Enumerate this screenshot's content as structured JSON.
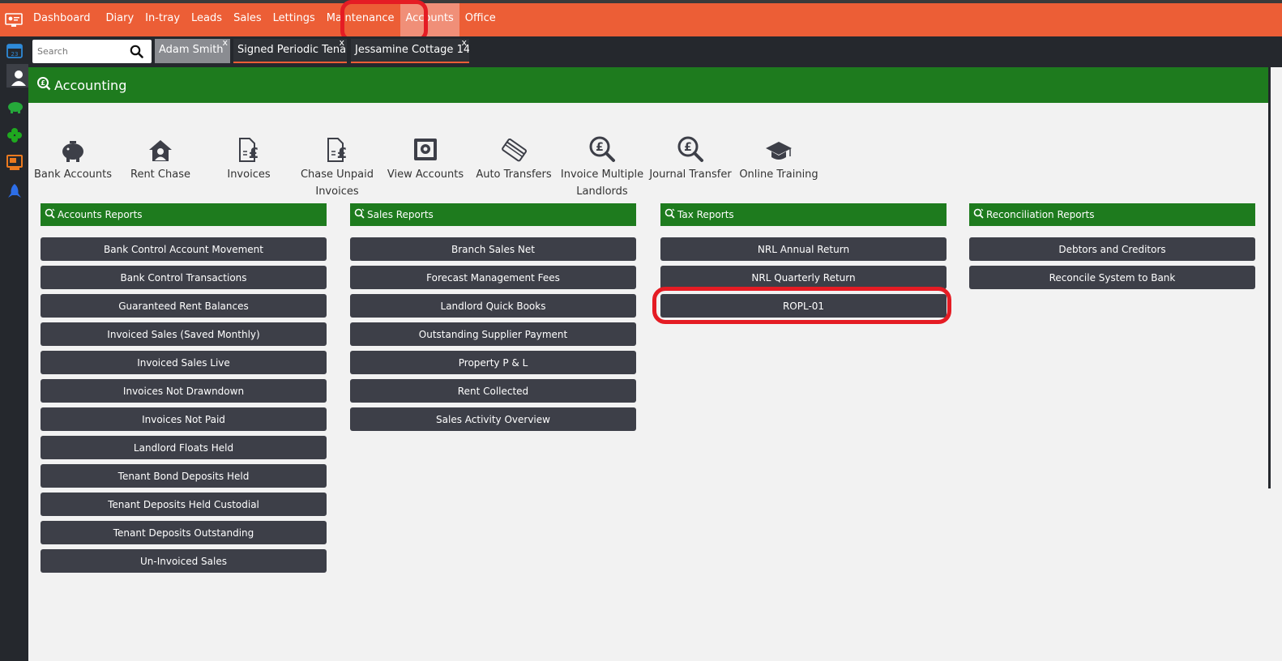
{
  "topnav": {
    "items": [
      {
        "label": "Dashboard",
        "active": false
      },
      {
        "label": "Diary",
        "active": false
      },
      {
        "label": "In-tray",
        "active": false
      },
      {
        "label": "Leads",
        "active": false
      },
      {
        "label": "Sales",
        "active": false
      },
      {
        "label": "Lettings",
        "active": false
      },
      {
        "label": "Maintenance",
        "active": false
      },
      {
        "label": "Accounts",
        "active": true
      },
      {
        "label": "Office",
        "active": false
      }
    ],
    "brand_color": "#ec5e36"
  },
  "search": {
    "placeholder": "Search"
  },
  "recent_tabs": [
    {
      "label": "Adam Smith",
      "close": "x"
    },
    {
      "label": "Signed Periodic Tena",
      "close": "x"
    },
    {
      "label": "Jessamine Cottage 14",
      "close": "x"
    }
  ],
  "sidebar": {
    "icons": [
      "calendar-icon",
      "contact-icon",
      "piggy-bank-icon",
      "clover-icon",
      "accounts-screen-icon",
      "rocket-icon"
    ]
  },
  "main": {
    "title": "Accounting",
    "header_color": "#1e7b1e"
  },
  "quick_links": [
    {
      "label": "Bank Accounts",
      "icon": "piggy-bank-icon"
    },
    {
      "label": "Rent Chase",
      "icon": "house-person-icon"
    },
    {
      "label": "Invoices",
      "icon": "invoice-icon"
    },
    {
      "label": "Chase Unpaid Invoices",
      "icon": "invoice-icon"
    },
    {
      "label": "View Accounts",
      "icon": "safe-icon"
    },
    {
      "label": "Auto Transfers",
      "icon": "cards-icon"
    },
    {
      "label": "Invoice Multiple Landlords",
      "icon": "pound-search-icon"
    },
    {
      "label": "Journal Transfer",
      "icon": "pound-search-icon"
    },
    {
      "label": "Online Training",
      "icon": "graduation-cap-icon"
    }
  ],
  "panels": [
    {
      "title": "Accounts Reports",
      "buttons": [
        "Bank Control Account Movement",
        "Bank Control Transactions",
        "Guaranteed Rent Balances",
        "Invoiced Sales (Saved Monthly)",
        "Invoiced Sales Live",
        "Invoices Not Drawndown",
        "Invoices Not Paid",
        "Landlord Floats Held",
        "Tenant Bond Deposits Held",
        "Tenant Deposits Held Custodial",
        "Tenant Deposits Outstanding",
        "Un-Invoiced Sales"
      ]
    },
    {
      "title": "Sales Reports",
      "buttons": [
        "Branch Sales Net",
        "Forecast Management Fees",
        "Landlord Quick Books",
        "Outstanding Supplier Payment",
        "Property P & L",
        "Rent Collected",
        "Sales Activity Overview"
      ]
    },
    {
      "title": "Tax Reports",
      "buttons": [
        "NRL Annual Return",
        "NRL Quarterly Return",
        "ROPL-01"
      ]
    },
    {
      "title": "Reconciliation Reports",
      "buttons": [
        "Debtors and Creditors",
        "Reconcile System to Bank"
      ]
    }
  ]
}
